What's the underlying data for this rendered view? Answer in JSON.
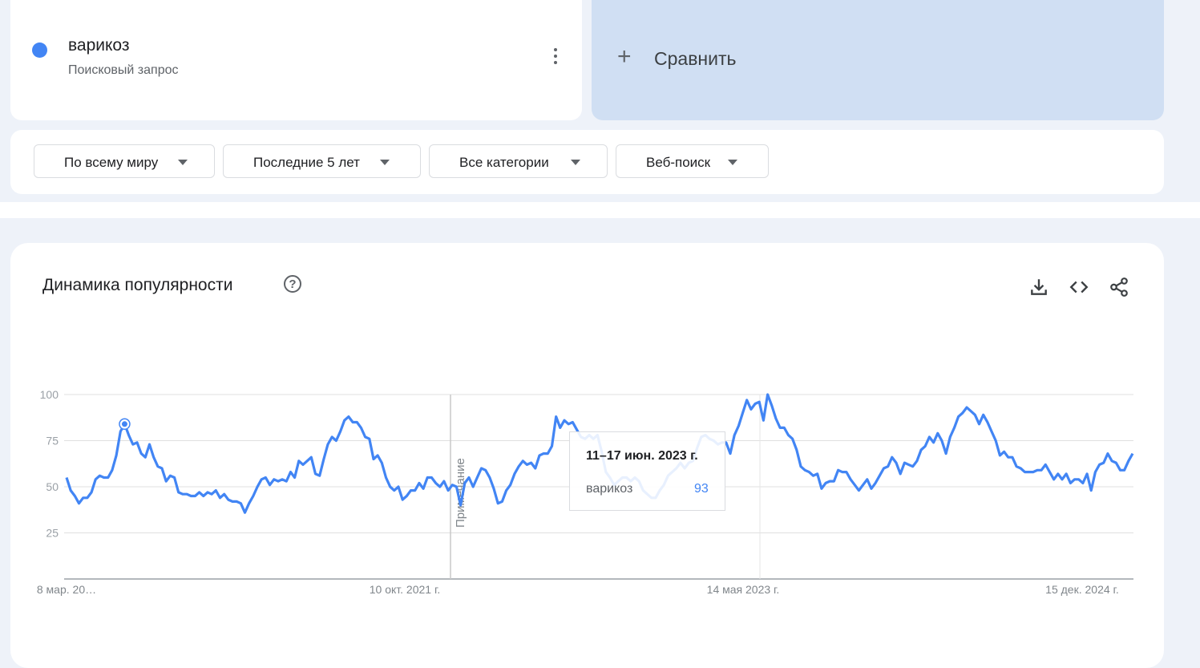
{
  "term": {
    "name": "варикоз",
    "subtitle": "Поисковый запрос",
    "color": "#4285f4"
  },
  "compare": {
    "label": "Сравнить"
  },
  "filters": [
    {
      "label": "По всему миру"
    },
    {
      "label": "Последние 5 лет"
    },
    {
      "label": "Все категории"
    },
    {
      "label": "Веб-поиск"
    }
  ],
  "chart_section": {
    "title": "Динамика популярности",
    "icons": [
      "help-icon",
      "download-icon",
      "embed-icon",
      "share-icon"
    ]
  },
  "tooltip": {
    "date": "11–17 июн. 2023 г.",
    "term": "варикоз",
    "value": "93"
  },
  "annotation": {
    "label": "Примечание"
  },
  "chart_data": {
    "type": "line",
    "x_tick_labels": [
      "8 мар. 20…",
      "10 окт. 2021 г.",
      "14 мая 2023 г.",
      "15 дек. 2024 г."
    ],
    "y_ticks": [
      100,
      75,
      50,
      25
    ],
    "ylim": [
      0,
      100
    ],
    "grid": true,
    "series": [
      {
        "name": "варикоз",
        "color": "#4285f4",
        "values": [
          55,
          48,
          45,
          41,
          44,
          44,
          47,
          54,
          56,
          55,
          55,
          59,
          67,
          80,
          84,
          78,
          73,
          74,
          68,
          66,
          73,
          66,
          61,
          60,
          53,
          56,
          55,
          47,
          46,
          46,
          45,
          45,
          47,
          45,
          47,
          46,
          48,
          44,
          46,
          43,
          42,
          42,
          41,
          36,
          41,
          45,
          50,
          54,
          55,
          51,
          54,
          53,
          54,
          53,
          58,
          55,
          64,
          62,
          64,
          66,
          57,
          56,
          65,
          73,
          77,
          75,
          80,
          86,
          88,
          85,
          85,
          82,
          77,
          76,
          65,
          67,
          63,
          55,
          50,
          48,
          50,
          43,
          45,
          48,
          48,
          52,
          49,
          55,
          55,
          52,
          50,
          53,
          48,
          51,
          50,
          40,
          52,
          55,
          50,
          55,
          60,
          59,
          55,
          49,
          41,
          42,
          48,
          51,
          57,
          61,
          64,
          62,
          63,
          60,
          67,
          68,
          68,
          72,
          88,
          82,
          86,
          84,
          85,
          81,
          77,
          76,
          78,
          76,
          78,
          69,
          58,
          55,
          51,
          53,
          55,
          55,
          53,
          55,
          53,
          48,
          46,
          44,
          44,
          48,
          51,
          56,
          58,
          60,
          63,
          60,
          63,
          64,
          71,
          77,
          78,
          76,
          75,
          73,
          74,
          74,
          68,
          78,
          83,
          90,
          97,
          92,
          95,
          96,
          86,
          100,
          94,
          87,
          82,
          82,
          78,
          76,
          70,
          61,
          59,
          58,
          56,
          57,
          49,
          52,
          53,
          53,
          59,
          58,
          58,
          54,
          51,
          48,
          51,
          54,
          49,
          52,
          56,
          60,
          61,
          66,
          63,
          57,
          63,
          62,
          61,
          64,
          70,
          72,
          77,
          74,
          79,
          75,
          68,
          77,
          82,
          88,
          90,
          93,
          91,
          89,
          84,
          89,
          85,
          80,
          75,
          67,
          69,
          66,
          66,
          61,
          60,
          58,
          58,
          58,
          59,
          59,
          62,
          58,
          54,
          57,
          54,
          57,
          52,
          54,
          54,
          52,
          57,
          48,
          58,
          62,
          63,
          68,
          64,
          63,
          59,
          59,
          64,
          68
        ]
      }
    ]
  }
}
